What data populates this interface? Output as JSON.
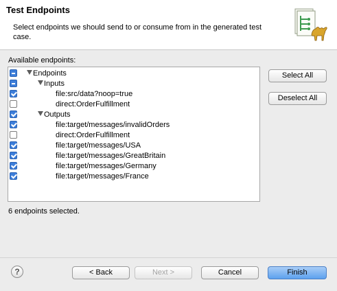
{
  "header": {
    "title": "Test Endpoints",
    "description": "Select endpoints we should send to or consume from in the generated test case.",
    "image_icon": "camel-wizard-banner-icon"
  },
  "available_label": "Available endpoints:",
  "tree": {
    "root": {
      "label": "Endpoints",
      "state": "mixed"
    },
    "inputs": {
      "label": "Inputs",
      "state": "mixed",
      "items": [
        {
          "label": "file:src/data?noop=true",
          "checked": true
        },
        {
          "label": "direct:OrderFulfillment",
          "checked": false
        }
      ]
    },
    "outputs": {
      "label": "Outputs",
      "state": "checked",
      "items": [
        {
          "label": "file:target/messages/invalidOrders",
          "checked": true
        },
        {
          "label": "direct:OrderFulfillment",
          "checked": false
        },
        {
          "label": "file:target/messages/USA",
          "checked": true
        },
        {
          "label": "file:target/messages/GreatBritain",
          "checked": true
        },
        {
          "label": "file:target/messages/Germany",
          "checked": true
        },
        {
          "label": "file:target/messages/France",
          "checked": true
        }
      ]
    }
  },
  "side_buttons": {
    "select_all": "Select All",
    "deselect_all": "Deselect All"
  },
  "status": "6 endpoints selected.",
  "footer": {
    "help_glyph": "?",
    "back": "< Back",
    "next": "Next >",
    "cancel": "Cancel",
    "finish": "Finish"
  },
  "colors": {
    "accent": "#3d7ed9",
    "default_button": "#5da1ee"
  }
}
